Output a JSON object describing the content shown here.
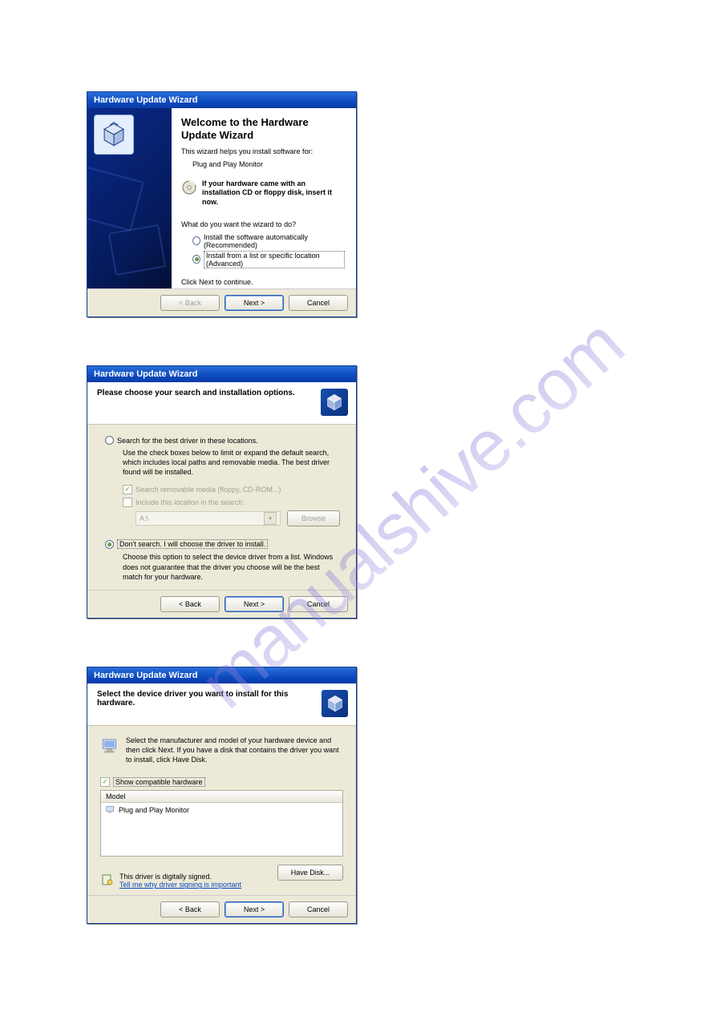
{
  "watermark": "manualshive.com",
  "wizard1": {
    "title": "Hardware Update Wizard",
    "headline": "Welcome to the Hardware Update Wizard",
    "intro": "This wizard helps you install software for:",
    "device": "Plug and Play Monitor",
    "cd_notice": "If your hardware came with an installation CD or floppy disk, insert it now.",
    "question": "What do you want the wizard to do?",
    "option_auto": "Install the software automatically (Recommended)",
    "option_specific": "Install from a list or specific location (Advanced)",
    "continue_hint": "Click Next to continue.",
    "buttons": {
      "back": "< Back",
      "next": "Next >",
      "cancel": "Cancel"
    }
  },
  "wizard2": {
    "title": "Hardware Update Wizard",
    "subheader": "Please choose your search and installation options.",
    "opt_search_label": "Search for the best driver in these locations.",
    "opt_search_desc": "Use the check boxes below to limit or expand the default search, which includes local paths and removable media. The best driver found will be installed.",
    "cb_removable": "Search removable media (floppy, CD-ROM...)",
    "cb_include": "Include this location in the search:",
    "combo_value": "A:\\",
    "browse": "Browse",
    "opt_dont_label": "Don't search. I will choose the driver to install.",
    "opt_dont_desc": "Choose this option to select the device driver from a list.  Windows does not guarantee that the driver you choose will be the best match for your hardware.",
    "buttons": {
      "back": "< Back",
      "next": "Next >",
      "cancel": "Cancel"
    }
  },
  "wizard3": {
    "title": "Hardware Update Wizard",
    "subheader": "Select the device driver you want to install for this hardware.",
    "info": "Select the manufacturer and model of your hardware device and then click Next. If you have a disk that contains the driver you want to install, click Have Disk.",
    "show_compatible": "Show compatible hardware",
    "model_header": "Model",
    "model_item": "Plug and Play Monitor",
    "signed_text": "This driver is digitally signed.",
    "signed_link": "Tell me why driver signing is important",
    "have_disk": "Have Disk...",
    "buttons": {
      "back": "< Back",
      "next": "Next >",
      "cancel": "Cancel"
    }
  }
}
